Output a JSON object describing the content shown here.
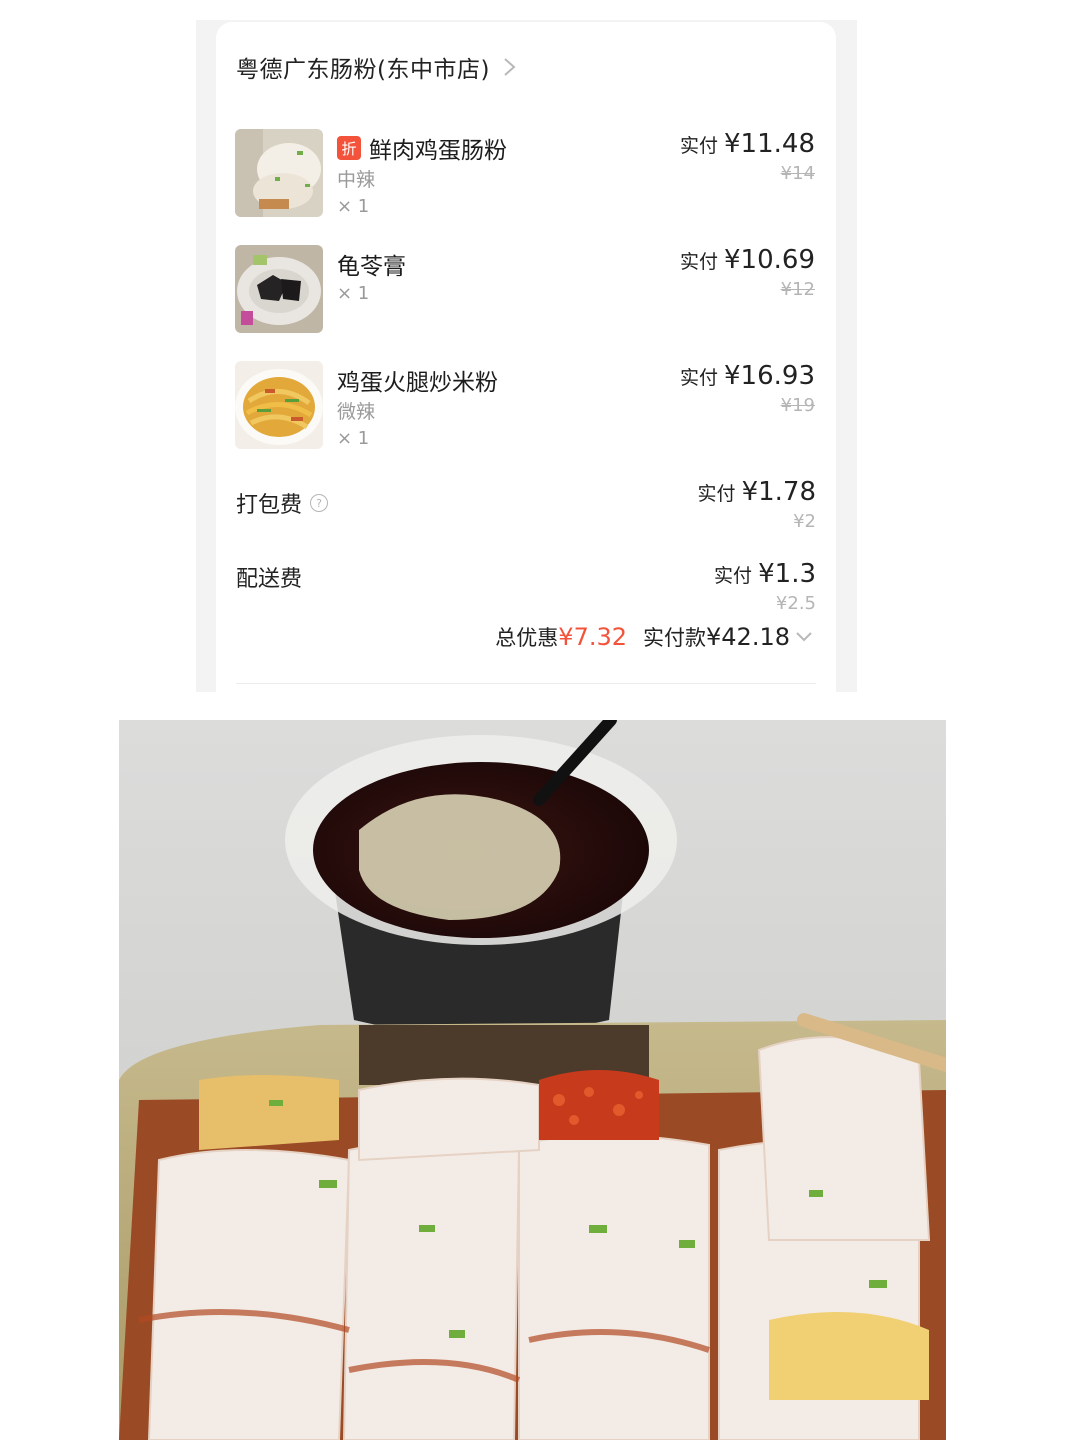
{
  "order": {
    "store_name": "粤德广东肠粉(东中市店)",
    "items": [
      {
        "discount_badge": "折",
        "name": "鲜肉鸡蛋肠粉",
        "spec": "中辣",
        "qty": "× 1",
        "paid_label": "实付",
        "paid_amount": "¥11.48",
        "original_price": "¥14"
      },
      {
        "name": "龟苓膏",
        "qty": "× 1",
        "paid_label": "实付",
        "paid_amount": "¥10.69",
        "original_price": "¥12"
      },
      {
        "name": "鸡蛋火腿炒米粉",
        "spec": "微辣",
        "qty": "× 1",
        "paid_label": "实付",
        "paid_amount": "¥16.93",
        "original_price": "¥19"
      }
    ],
    "fees": [
      {
        "label": "打包费",
        "paid_label": "实付",
        "paid_amount": "¥1.78",
        "original_price": "¥2"
      },
      {
        "label": "配送费",
        "paid_label": "实付",
        "paid_amount": "¥1.3",
        "original_price": "¥2.5"
      }
    ],
    "summary": {
      "discount_label": "总优惠",
      "discount_amount": "¥7.32",
      "total_label": "实付款",
      "total_amount": "¥42.18"
    }
  },
  "colors": {
    "accent": "#f3533a",
    "muted_text": "#9a9a9a",
    "strike_text": "#b5b5b5"
  },
  "icons": {
    "store_chevron": "chevron-right-icon",
    "packing_help": "question-circle-icon",
    "summary_toggle": "chevron-down-icon"
  }
}
